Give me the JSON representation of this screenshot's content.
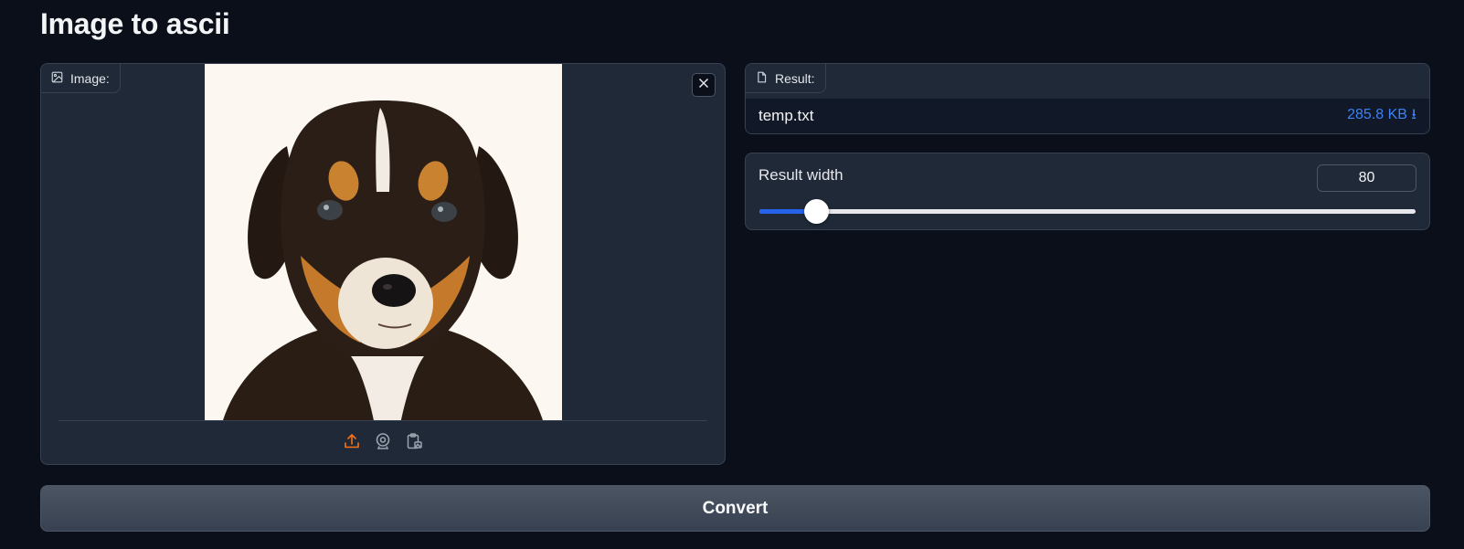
{
  "app": {
    "title": "Image to ascii"
  },
  "image_input": {
    "label": "Image:",
    "label_icon": "image-icon",
    "clear_icon": "close-icon",
    "sources": [
      {
        "name": "upload",
        "icon": "upload-icon",
        "active": true
      },
      {
        "name": "webcam",
        "icon": "webcam-icon",
        "active": false
      },
      {
        "name": "clipboard",
        "icon": "clipboard-icon",
        "active": false
      }
    ]
  },
  "result": {
    "label": "Result:",
    "label_icon": "file-icon",
    "file_name": "temp.txt",
    "file_size": "285.8 KB ⭳"
  },
  "width_slider": {
    "label": "Result width",
    "value": "80",
    "fraction": 0.087
  },
  "actions": {
    "convert_label": "Convert"
  },
  "colors": {
    "background": "#0b0f19",
    "panel": "#1f2937",
    "accent_blue": "#2563eb",
    "link_blue": "#3b82f6",
    "upload_orange": "#f97316"
  }
}
